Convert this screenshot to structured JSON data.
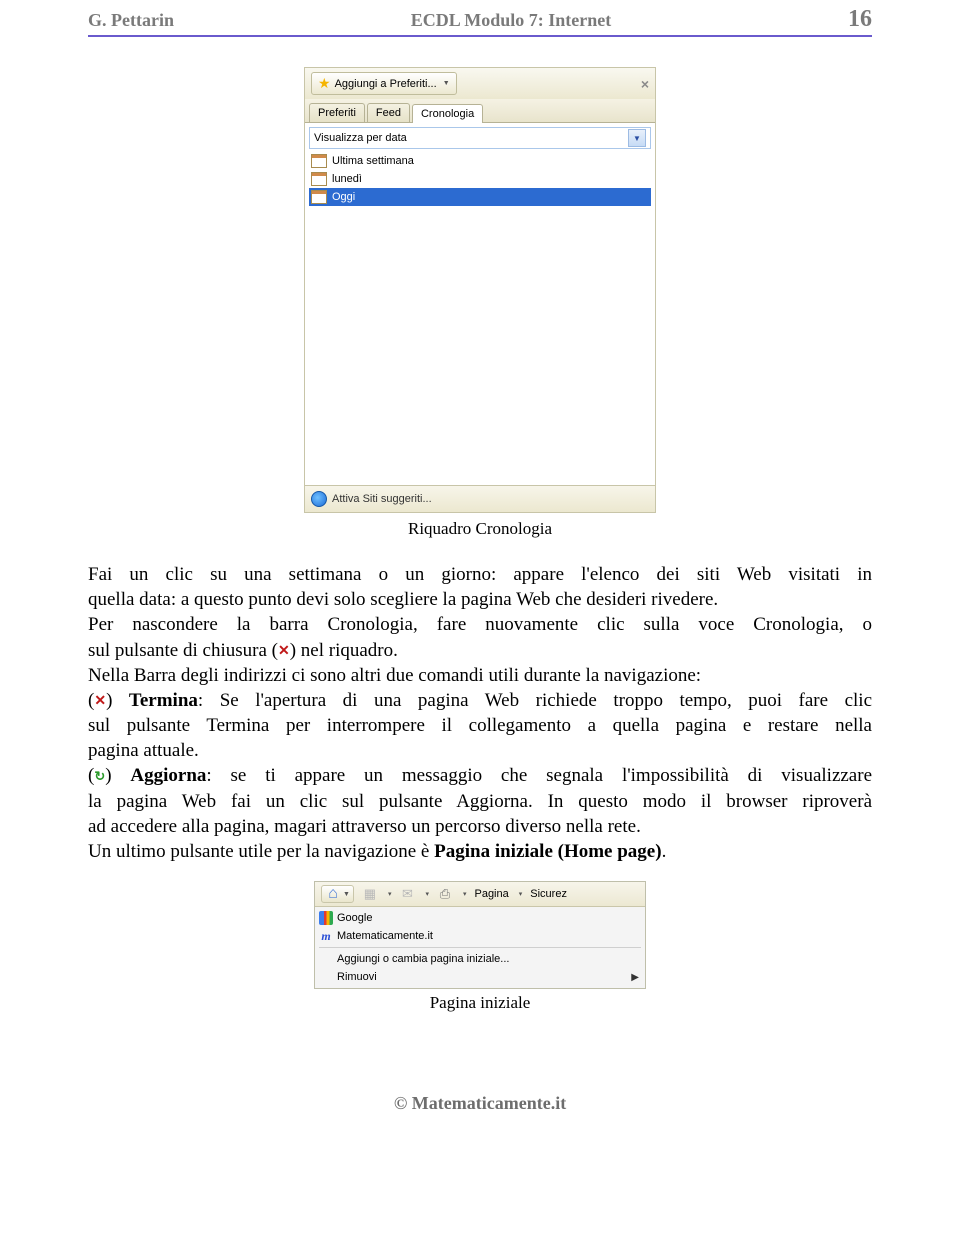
{
  "header": {
    "author": "G. Pettarin",
    "title": "ECDL Modulo 7: Internet",
    "page": "16"
  },
  "panel": {
    "addFavorites": "Aggiungi a Preferiti...",
    "tabs": [
      "Preferiti",
      "Feed",
      "Cronologia"
    ],
    "dropdown": "Visualizza per data",
    "items": [
      "Ultima settimana",
      "lunedì",
      "Oggi"
    ],
    "footer": "Attiva Siti suggeriti..."
  },
  "caption1": "Riquadro Cronologia",
  "text": {
    "p1a": "Fai un clic su una settimana o un giorno: appare l'elenco dei siti Web visitati in",
    "p1b": "quella data: a questo punto devi solo scegliere la pagina Web che desideri rivedere.",
    "p2a": "Per nascondere la barra Cronologia, fare nuovamente clic sulla voce Cronologia, o",
    "p2b": "sul pulsante di chiusura (",
    "p2c": ") nel riquadro.",
    "p3": "Nella Barra degli indirizzi ci sono altri due comandi utili durante la navigazione:",
    "p4a": "(",
    "p4b": ") ",
    "termina": "Termina",
    "p4c": ": Se l'apertura di una pagina Web richiede troppo tempo, puoi fare clic",
    "p4d": "sul pulsante Termina per interrompere il collegamento a quella pagina e restare nella",
    "p4e": "pagina attuale.",
    "p5a": "(",
    "p5b": ") ",
    "aggiorna": "Aggiorna",
    "p5c": ": se ti appare un messaggio che segnala l'impossibilità di visualizzare",
    "p5d": "la pagina Web fai un clic sul pulsante Aggiorna. In questo modo il browser riproverà",
    "p5e": "ad accedere alla pagina, magari attraverso un percorso diverso nella rete.",
    "p6a": "Un ultimo pulsante utile per la navigazione è ",
    "p6b": "Pagina iniziale (Home page)",
    "p6c": "."
  },
  "menu2": {
    "toolbar": [
      "Pagina",
      "Sicurez"
    ],
    "items": [
      "Google",
      "Matematicamente.it",
      "Aggiungi o cambia pagina iniziale...",
      "Rimuovi"
    ]
  },
  "caption2": "Pagina iniziale",
  "footer": "© Matematicamente.it"
}
